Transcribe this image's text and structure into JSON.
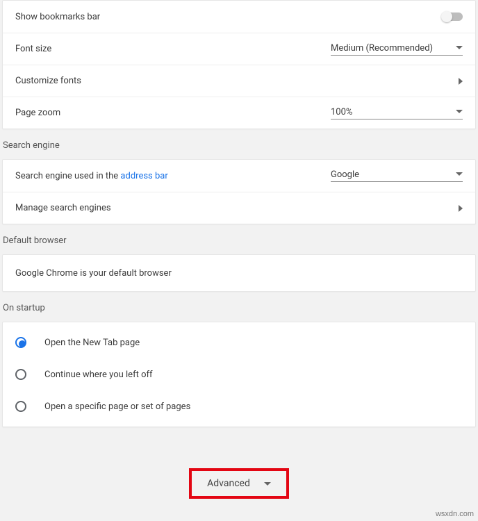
{
  "appearance": {
    "bookmarks_label": "Show bookmarks bar",
    "font_size_label": "Font size",
    "font_size_value": "Medium (Recommended)",
    "customize_fonts_label": "Customize fonts",
    "page_zoom_label": "Page zoom",
    "page_zoom_value": "100%"
  },
  "search_engine": {
    "heading": "Search engine",
    "used_label_pre": "Search engine used in the ",
    "used_label_link": "address bar",
    "used_value": "Google",
    "manage_label": "Manage search engines"
  },
  "default_browser": {
    "heading": "Default browser",
    "status": "Google Chrome is your default browser"
  },
  "startup": {
    "heading": "On startup",
    "options": [
      "Open the New Tab page",
      "Continue where you left off",
      "Open a specific page or set of pages"
    ],
    "selected": 0
  },
  "advanced_label": "Advanced",
  "watermark": "wsxdn.com"
}
